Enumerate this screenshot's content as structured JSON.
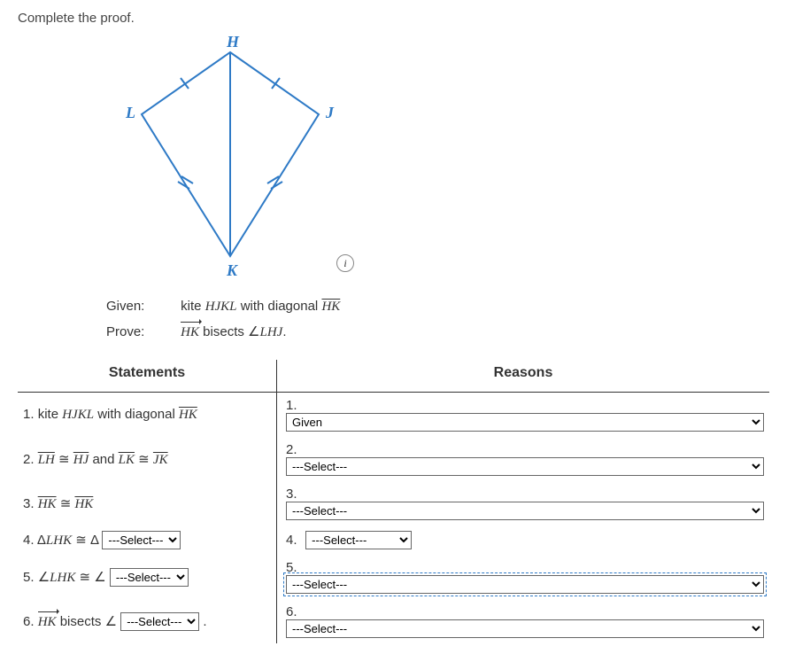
{
  "prompt": "Complete the proof.",
  "figure": {
    "vertices": {
      "H": "H",
      "J": "J",
      "K": "K",
      "L": "L"
    }
  },
  "given_label": "Given:",
  "given_text_prefix": "kite ",
  "given_kite_name": "HJKL",
  "given_text_mid": " with diagonal ",
  "given_diag": "HK",
  "prove_label": "Prove:",
  "prove_ray": "HK",
  "prove_text_mid": " bisects ",
  "prove_angle_prefix": "∠",
  "prove_angle": "LHJ",
  "prove_period": ".",
  "headers": {
    "statements": "Statements",
    "reasons": "Reasons"
  },
  "statements": {
    "s1_num": "1. ",
    "s1_a": "kite ",
    "s1_kite": "HJKL",
    "s1_b": " with diagonal ",
    "s1_diag": "HK",
    "s2_num": "2. ",
    "s2_seg1": "LH",
    "s2_cong": " ≅ ",
    "s2_seg2": "HJ",
    "s2_and": " and ",
    "s2_seg3": "LK",
    "s2_cong2": " ≅ ",
    "s2_seg4": "JK",
    "s3_num": "3. ",
    "s3_seg1": "HK",
    "s3_cong": " ≅ ",
    "s3_seg2": "HK",
    "s4_num": "4. ",
    "s4_pref": "Δ",
    "s4_tri1": "LHK",
    "s4_cong": " ≅ ",
    "s4_pref2": "Δ",
    "s5_num": "5. ",
    "s5_pref": "∠",
    "s5_ang1": "LHK",
    "s5_cong": " ≅ ",
    "s5_pref2": "∠",
    "s6_num": "6. ",
    "s6_ray": "HK",
    "s6_text": " bisects ",
    "s6_pref": "∠",
    "s6_period": " ."
  },
  "reasons": {
    "r1_num": "1.",
    "r1_sel": "Given",
    "r2_num": "2.",
    "r3_num": "3.",
    "r4_num": "4.",
    "r5_num": "5.",
    "r6_num": "6."
  },
  "select_placeholder": "---Select---"
}
